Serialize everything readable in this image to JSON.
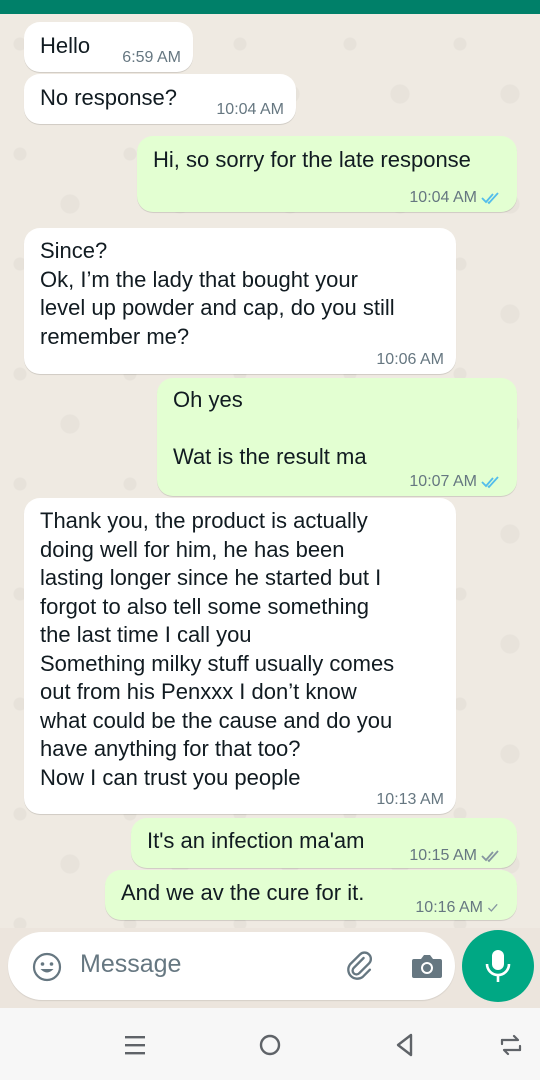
{
  "colors": {
    "header": "#008069",
    "incoming": "#FFFFFF",
    "outgoing": "#E3FFD2",
    "read_ticks": "#53BDEB",
    "sent_tick": "#8696A0",
    "accent": "#00A884"
  },
  "messages": [
    {
      "direction": "incoming",
      "text": "Hello",
      "time": "6:59 AM"
    },
    {
      "direction": "incoming",
      "text": "No response?",
      "time": "10:04 AM"
    },
    {
      "direction": "outgoing",
      "text": "Hi, so sorry for the late response",
      "time": "10:04 AM",
      "status": "read"
    },
    {
      "direction": "incoming",
      "text": "Since?\nOk, I’m the lady that bought your\nlevel up powder and cap, do you still\nremember me?",
      "time": "10:06 AM"
    },
    {
      "direction": "outgoing",
      "text": "Oh yes\n\nWat is the result ma",
      "time": "10:07 AM",
      "status": "read"
    },
    {
      "direction": "incoming",
      "text": "Thank you, the product is actually\ndoing well for him, he has been\nlasting longer since he started but I\nforgot to also tell some something\nthe last time I call you\nSomething milky stuff usually comes\nout from his Penxxx I don’t know\nwhat could be the cause and do you\nhave anything for that too?\nNow I can trust you people",
      "time": "10:13 AM"
    },
    {
      "direction": "outgoing",
      "text": "It's an infection ma'am",
      "time": "10:15 AM",
      "status": "delivered"
    },
    {
      "direction": "outgoing",
      "text": "And we av the cure for it.",
      "time": "10:16 AM",
      "status": "sent"
    }
  ],
  "composer": {
    "placeholder": "Message",
    "icons": [
      "emoji-icon",
      "paperclip-icon",
      "camera-icon",
      "microphone-icon"
    ]
  },
  "navbar": {
    "icons": [
      "recents-icon",
      "home-icon",
      "back-icon",
      "rotate-icon"
    ]
  }
}
